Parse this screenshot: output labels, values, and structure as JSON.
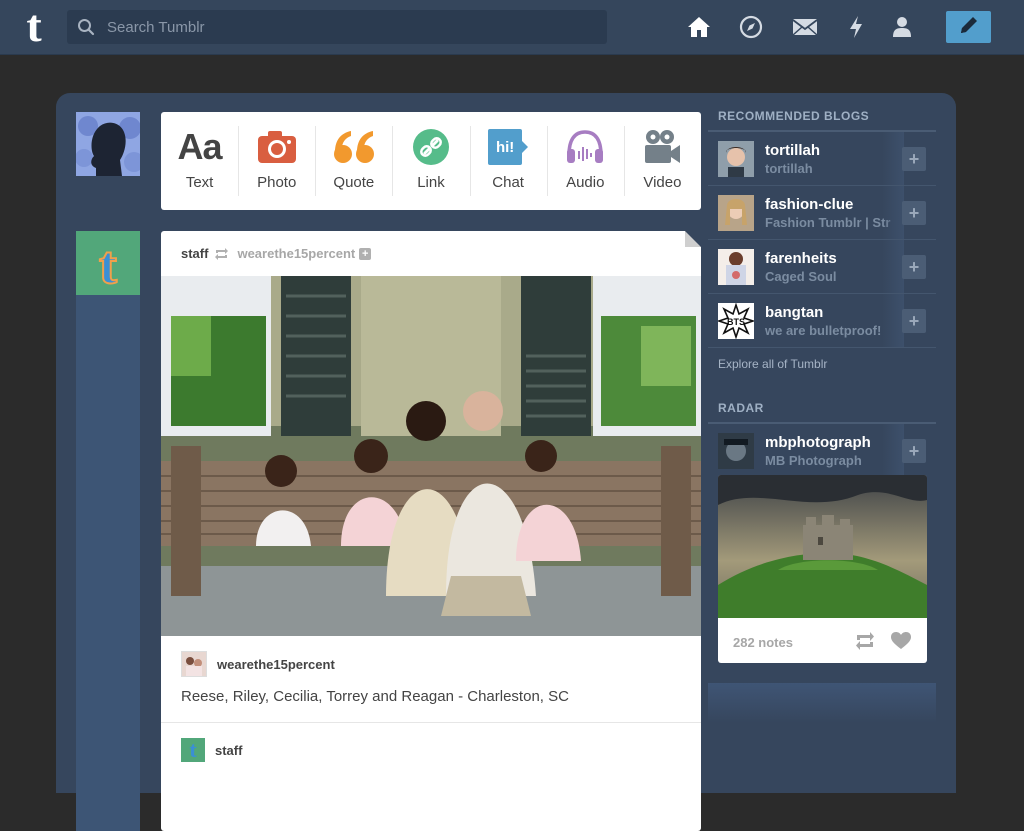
{
  "header": {
    "logo": "t",
    "search_placeholder": "Search Tumblr",
    "nav_icons": [
      "home-icon",
      "explore-compass-icon",
      "inbox-mail-icon",
      "activity-lightning-icon",
      "account-person-icon"
    ],
    "compose_icon": "pencil-icon",
    "colors": {
      "bar": "#35465c",
      "compose": "#529ecc"
    }
  },
  "composer": {
    "types": [
      {
        "label": "Text",
        "icon": "text-aa-icon",
        "color": "#444444"
      },
      {
        "label": "Photo",
        "icon": "camera-icon",
        "color": "#d95e40"
      },
      {
        "label": "Quote",
        "icon": "quote-icon",
        "color": "#f2992e"
      },
      {
        "label": "Link",
        "icon": "link-icon",
        "color": "#56bc8a"
      },
      {
        "label": "Chat",
        "icon": "chat-bubble-icon",
        "color": "#529ecc"
      },
      {
        "label": "Audio",
        "icon": "headphones-icon",
        "color": "#a77dc2"
      },
      {
        "label": "Video",
        "icon": "video-camera-icon",
        "color": "#748089"
      }
    ],
    "text_glyph": "Aa",
    "chat_glyph": "hi!"
  },
  "post": {
    "author": "staff",
    "reblogged_from": "wearethe15percent",
    "caption_author": "wearethe15percent",
    "caption": "Reese, Riley, Cecilia, Torrey and Reagan - Charleston, SC",
    "next_author": "staff"
  },
  "sidebar": {
    "recommended_title": "RECOMMENDED BLOGS",
    "blogs": [
      {
        "name": "tortillah",
        "subtitle": "tortillah"
      },
      {
        "name": "fashion-clue",
        "subtitle": "Fashion Tumblr | Str"
      },
      {
        "name": "farenheits",
        "subtitle": "Caged Soul"
      },
      {
        "name": "bangtan",
        "subtitle": "we are bulletproof!"
      }
    ],
    "explore_link": "Explore all of Tumblr",
    "radar_title": "RADAR",
    "radar": {
      "name": "mbphotograph",
      "subtitle": "MB Photograph",
      "notes": "282 notes"
    }
  }
}
